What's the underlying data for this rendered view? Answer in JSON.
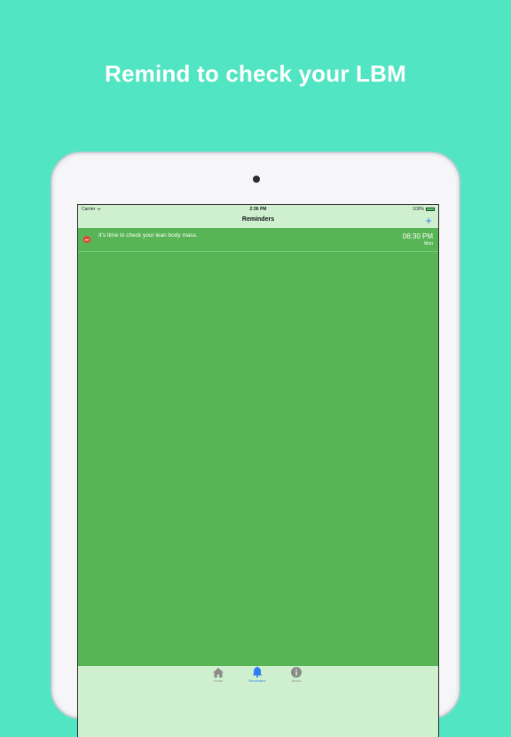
{
  "headline": "Remind to check your LBM",
  "status_bar": {
    "carrier": "Carrier",
    "time": "2:36 PM",
    "battery": "100%",
    "battery_level": 1.0
  },
  "nav": {
    "title": "Reminders",
    "add_label": "+"
  },
  "reminders": [
    {
      "text": "It's time to check your lean body mass.",
      "time": "06:30 PM",
      "day": "Mon"
    }
  ],
  "tabs": [
    {
      "label": "Home",
      "icon": "home-icon",
      "active": false
    },
    {
      "label": "Reminders",
      "icon": "bell-icon",
      "active": true
    },
    {
      "label": "About",
      "icon": "info-icon",
      "active": false
    }
  ],
  "colors": {
    "background": "#52e5c3",
    "content": "#58b556",
    "bars": "#cff0cf",
    "accent": "#2f7cf6",
    "delete": "#e8423a"
  }
}
